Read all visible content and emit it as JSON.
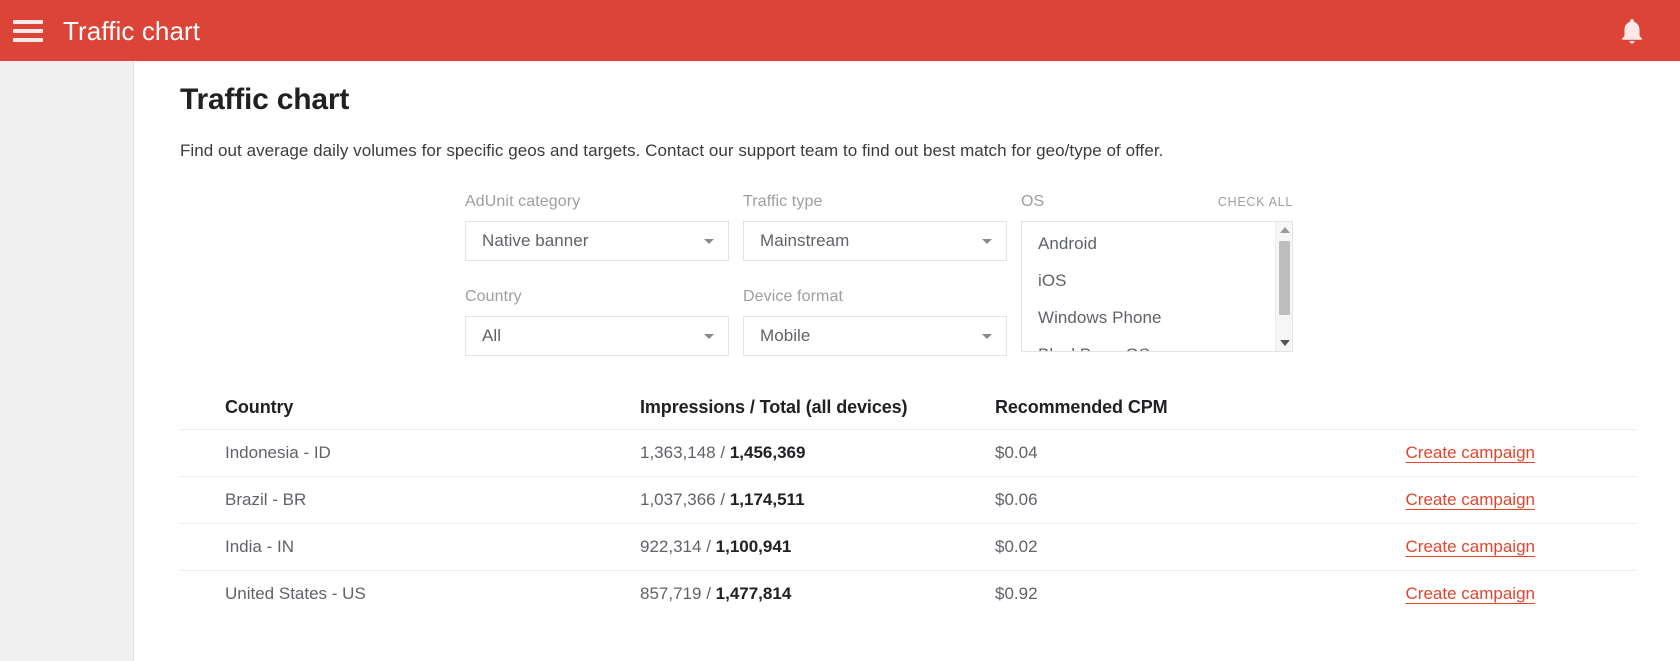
{
  "appbar": {
    "title": "Traffic chart",
    "menu_icon": "hamburger-menu-icon",
    "notifications_icon": "bell-icon",
    "background_color": "#db4437"
  },
  "page": {
    "title": "Traffic chart",
    "description": "Find out average daily volumes for specific geos and targets. Contact our support team to find out best match for geo/type of offer."
  },
  "filters": {
    "adunit_category": {
      "label": "AdUnit category",
      "value": "Native banner"
    },
    "traffic_type": {
      "label": "Traffic type",
      "value": "Mainstream"
    },
    "country": {
      "label": "Country",
      "value": "All"
    },
    "device_format": {
      "label": "Device format",
      "value": "Mobile"
    },
    "os": {
      "label": "OS",
      "check_all_label": "CHECK ALL",
      "options": [
        "Android",
        "iOS",
        "Windows Phone",
        "BlackBerry OS"
      ]
    }
  },
  "table": {
    "columns": [
      "Country",
      "Impressions / Total (all devices)",
      "Recommended CPM",
      ""
    ],
    "action_label": "Create campaign",
    "rows": [
      {
        "country": "Indonesia - ID",
        "impressions": "1,363,148",
        "total": "1,456,369",
        "cpm": "$0.04"
      },
      {
        "country": "Brazil - BR",
        "impressions": "1,037,366",
        "total": "1,174,511",
        "cpm": "$0.06"
      },
      {
        "country": "India - IN",
        "impressions": "922,314",
        "total": "1,100,941",
        "cpm": "$0.02"
      },
      {
        "country": "United States - US",
        "impressions": "857,719",
        "total": "1,477,814",
        "cpm": "$0.92"
      }
    ]
  },
  "colors": {
    "brand_red": "#db4437",
    "link_red": "#e2452f",
    "sidebar_gray": "#f0f0f0"
  }
}
